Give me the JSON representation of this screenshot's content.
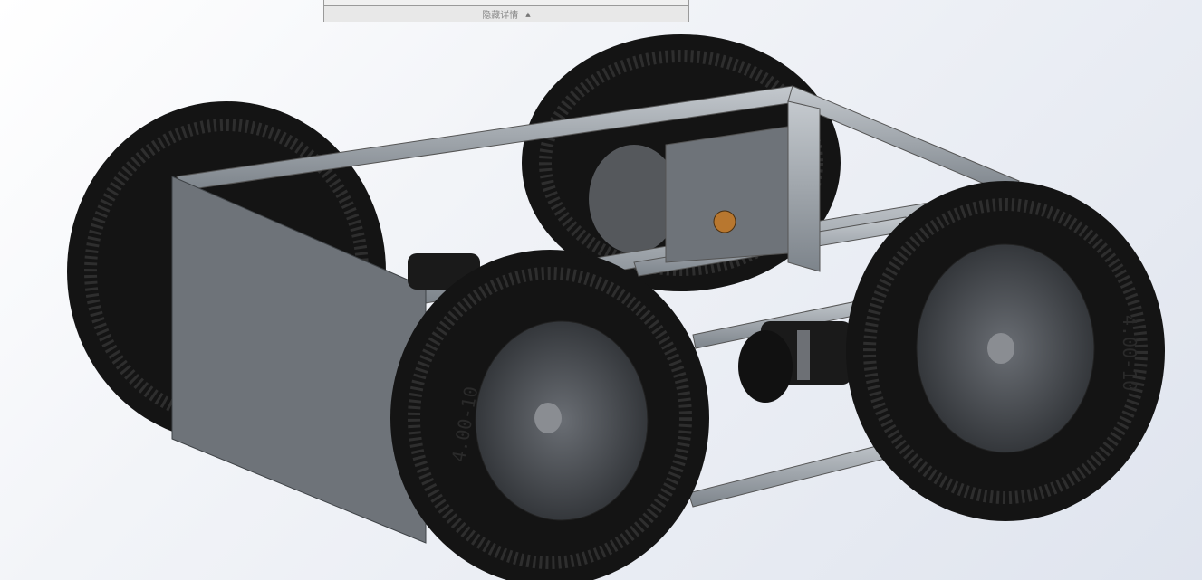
{
  "details_panel": {
    "toggle_label": "隐藏详情",
    "toggle_icon": "chevron-up-icon"
  },
  "model": {
    "tire_marking": "4.00-10"
  },
  "colors": {
    "frame": "#9aa1a8",
    "tire": "#141414",
    "rim": "#4a4d52",
    "panel": "#6e7379",
    "bearing": "#b8772f"
  }
}
